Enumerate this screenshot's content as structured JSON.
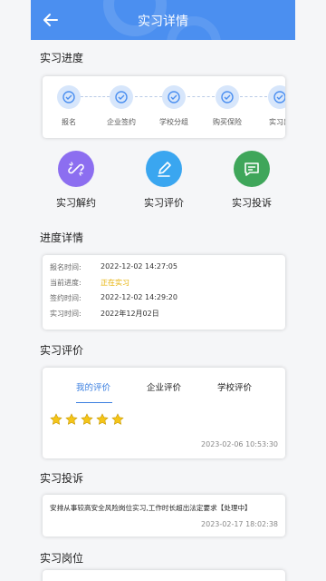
{
  "header": {
    "title": "实习详情"
  },
  "progress": {
    "title": "实习进度",
    "steps": [
      {
        "label": "报名"
      },
      {
        "label": "企业签约"
      },
      {
        "label": "学校分组"
      },
      {
        "label": "购买保险"
      },
      {
        "label": "实习出"
      }
    ]
  },
  "actions": [
    {
      "label": "实习解约",
      "icon": "unlink-icon",
      "color": "#8c6ef0"
    },
    {
      "label": "实习评价",
      "icon": "edit-icon",
      "color": "#3aa6f0"
    },
    {
      "label": "实习投诉",
      "icon": "message-icon",
      "color": "#3fa65a"
    }
  ],
  "detail": {
    "title": "进度详情",
    "rows": [
      {
        "key": "报名时间:",
        "value": "2022-12-02 14:27:05"
      },
      {
        "key": "当前进度:",
        "value": "正在实习"
      },
      {
        "key": "签约时间:",
        "value": "2022-12-02 14:29:20"
      },
      {
        "key": "实习时间:",
        "value": "2022年12月02日"
      }
    ],
    "highlight_color": "#e6b000"
  },
  "evaluation": {
    "title": "实习评价",
    "tabs": [
      {
        "label": "我的评价"
      },
      {
        "label": "企业评价"
      },
      {
        "label": "学校评价"
      }
    ],
    "rating": 5,
    "time": "2023-02-06 10:53:30"
  },
  "complaint": {
    "title": "实习投诉",
    "text": "安排从事较高安全风险岗位实习,工作时长超出法定要求【处理中】",
    "time": "2023-02-17 18:02:38"
  },
  "post": {
    "title": "实习岗位"
  },
  "colors": {
    "accent": "#4b8ff0",
    "star": "#f5c518"
  }
}
